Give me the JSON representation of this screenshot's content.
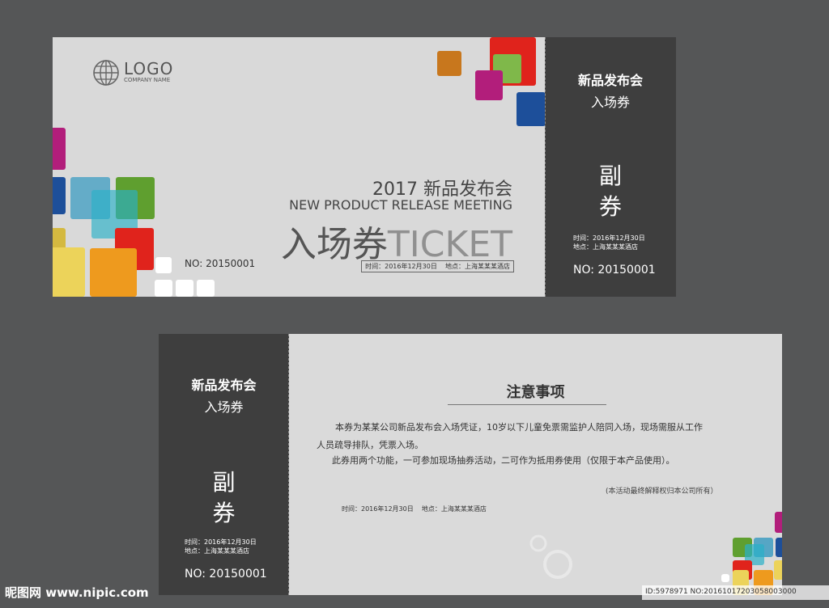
{
  "front": {
    "logo_text": "LOGO",
    "company_name": "COMPANY NAME",
    "heading_cn": "2017 新品发布会",
    "heading_en": "NEW PRODUCT RELEASE MEETING",
    "title_cn": "入场券",
    "title_en": "TICKET",
    "info_line": "时间：2016年12月30日    地点：上海某某某酒店",
    "number": "NO: 20150001",
    "stub": {
      "event": "新品发布会",
      "label": "入场券",
      "type_char1": "副",
      "type_char2": "券",
      "time": "时间：2016年12月30日",
      "place": "地点：上海某某某酒店",
      "number": "NO: 20150001"
    }
  },
  "back": {
    "stub": {
      "event": "新品发布会",
      "label": "入场券",
      "type_char1": "副",
      "type_char2": "券",
      "time": "时间：2016年12月30日",
      "place": "地点：上海某某某酒店",
      "number": "NO: 20150001"
    },
    "notice_title": "注意事项",
    "para1_line1": "本券为某某公司新品发布会入场凭证，10岁以下儿童免票需监护人陪同入场，现场需服从工作",
    "para1_line2": "人员疏导排队，凭票入场。",
    "para2": "此券用两个功能，一可参加现场抽券活动，二可作为抵用券使用（仅限于本产品使用）。",
    "note": "(本活动最终解释权归本公司所有）",
    "info_line": "时间：2016年12月30日    地点：上海某某某酒店"
  },
  "watermark": {
    "site": "昵图网 www.nipic.com",
    "id": "ID:5978971 NO:20161017203058003000"
  },
  "colors": {
    "background": "#555657",
    "ticket": "#d9d9d9",
    "stub": "#3e3e3e",
    "red": "#e0231c",
    "green": "#5f9f2f",
    "blue": "#1d4f9a",
    "orange": "#ee9a1e",
    "magenta": "#b21e7b",
    "cyan": "#56c3d6",
    "yellow": "#ecd35a"
  }
}
